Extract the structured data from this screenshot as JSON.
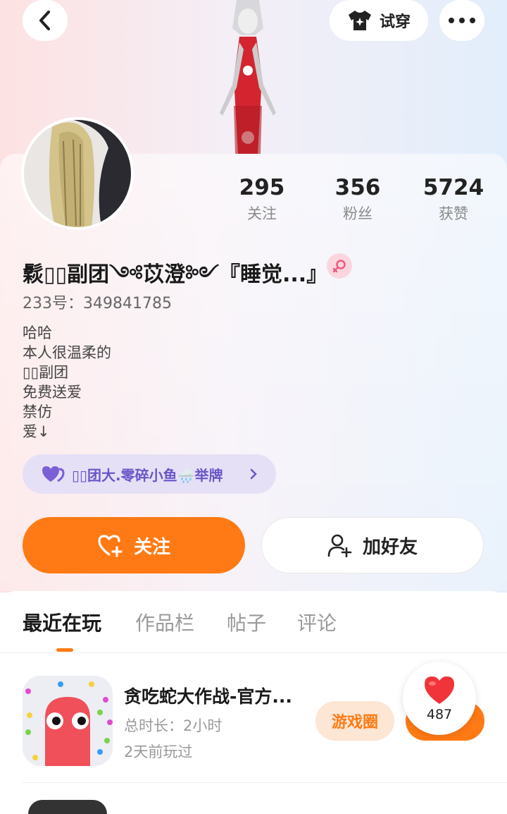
{
  "header": {
    "try_on_label": "试穿"
  },
  "stats": [
    {
      "value": "295",
      "label": "关注"
    },
    {
      "value": "356",
      "label": "粉丝"
    },
    {
      "value": "5724",
      "label": "获赞"
    }
  ],
  "profile": {
    "name": "鬏▯▯副团༺苡澄༻『睡觉...』",
    "uid": "233号：349841785",
    "bio": [
      "哈哈",
      "本人很温柔的",
      "▯▯副团",
      "免费送爱",
      "禁仿",
      "爱↓"
    ],
    "badge_text": "▯▯团大.零碎小鱼🌧️举牌"
  },
  "actions": {
    "follow_label": "关注",
    "add_friend_label": "加好友"
  },
  "tabs": [
    {
      "label": "最近在玩",
      "active": true
    },
    {
      "label": "作品栏",
      "active": false
    },
    {
      "label": "帖子",
      "active": false
    },
    {
      "label": "评论",
      "active": false
    }
  ],
  "games": [
    {
      "title": "贪吃蛇大作战-官方...",
      "duration": "总时长：2小时",
      "last_played": "2天前玩过",
      "circle_label": "游戏圈",
      "like_count": "487"
    }
  ],
  "colors": {
    "accent": "#ff7a14",
    "badge_bg": "#e6e0f6",
    "badge_text": "#6a55c8"
  }
}
